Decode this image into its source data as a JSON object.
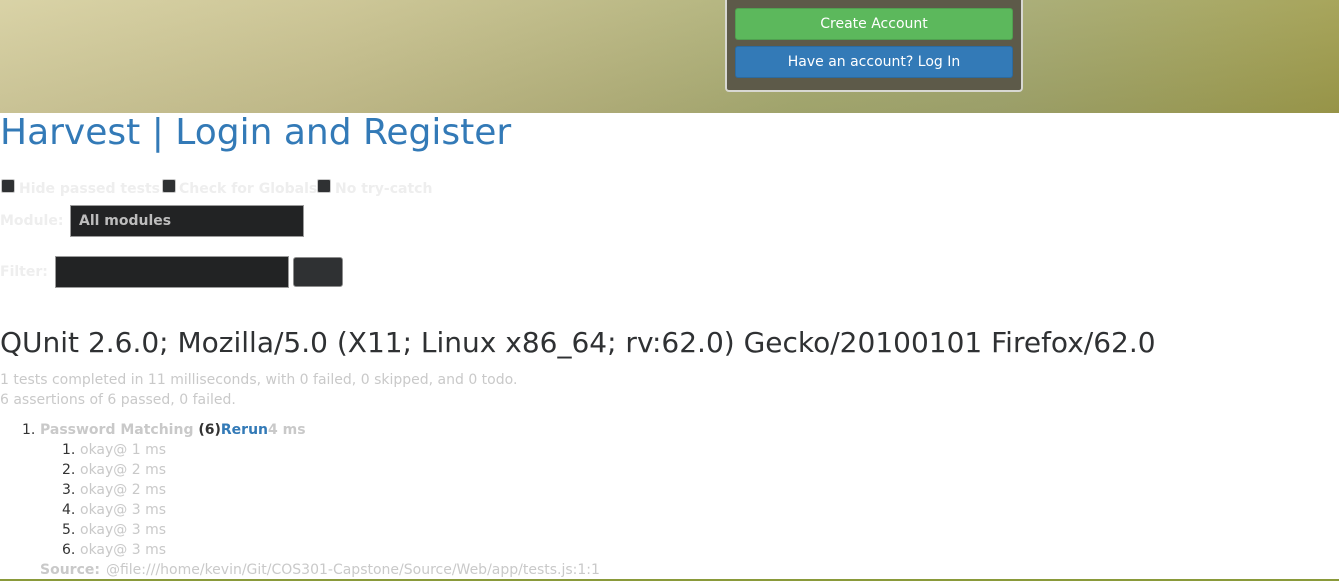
{
  "header": {
    "create_account": "Create Account",
    "login": "Have an account? Log In"
  },
  "page_title": "Harvest | Login and Register",
  "toolbar": {
    "hide_passed": "Hide passed tests",
    "check_globals": "Check for Globals",
    "no_try_catch": "No try-catch"
  },
  "module": {
    "label": "Module:",
    "selected": "All modules"
  },
  "filter": {
    "label": "Filter:",
    "value": ""
  },
  "user_agent": "QUnit 2.6.0; Mozilla/5.0 (X11; Linux x86_64; rv:62.0) Gecko/20100101 Firefox/62.0",
  "results": {
    "line1": "1 tests completed in 11 milliseconds, with 0 failed, 0 skipped, and 0 todo.",
    "line2": "6 assertions of 6 passed, 0 failed."
  },
  "tests": [
    {
      "number": "1.",
      "name": "Password Matching",
      "count": "(6)",
      "rerun": "Rerun",
      "time": "4 ms",
      "assertions": [
        {
          "number": "1.",
          "text": "okay@ 1 ms"
        },
        {
          "number": "2.",
          "text": "okay@ 2 ms"
        },
        {
          "number": "3.",
          "text": "okay@ 2 ms"
        },
        {
          "number": "4.",
          "text": "okay@ 3 ms"
        },
        {
          "number": "5.",
          "text": "okay@ 3 ms"
        },
        {
          "number": "6.",
          "text": "okay@ 3 ms"
        }
      ],
      "source_label": "Source:",
      "source": "@file:///home/kevin/Git/COS301-Capstone/Source/Web/app/tests.js:1:1"
    }
  ]
}
